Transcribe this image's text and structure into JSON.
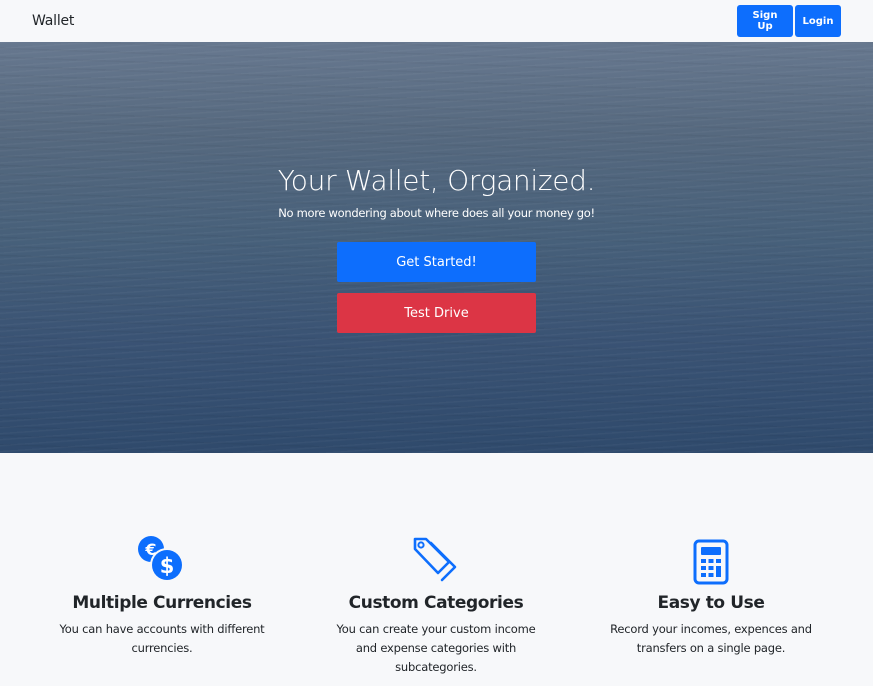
{
  "navbar": {
    "brand": "Wallet",
    "signup_label": "Sign Up",
    "login_label": "Login"
  },
  "hero": {
    "title": "Your Wallet, Organized.",
    "subtitle": "No more wondering about where does all your money go!",
    "get_started_label": "Get Started!",
    "test_drive_label": "Test Drive"
  },
  "features": [
    {
      "icon": "currency-exchange-icon",
      "title": "Multiple Currencies",
      "text": "You can have accounts with different currencies."
    },
    {
      "icon": "tags-icon",
      "title": "Custom Categories",
      "text": "You can create your custom income and expense categories with subcategories."
    },
    {
      "icon": "calculator-icon",
      "title": "Easy to Use",
      "text": "Record your incomes, expences and transfers on a single page."
    }
  ],
  "colors": {
    "primary": "#0d6efd",
    "danger": "#dc3545",
    "background": "#f7f8fa"
  }
}
